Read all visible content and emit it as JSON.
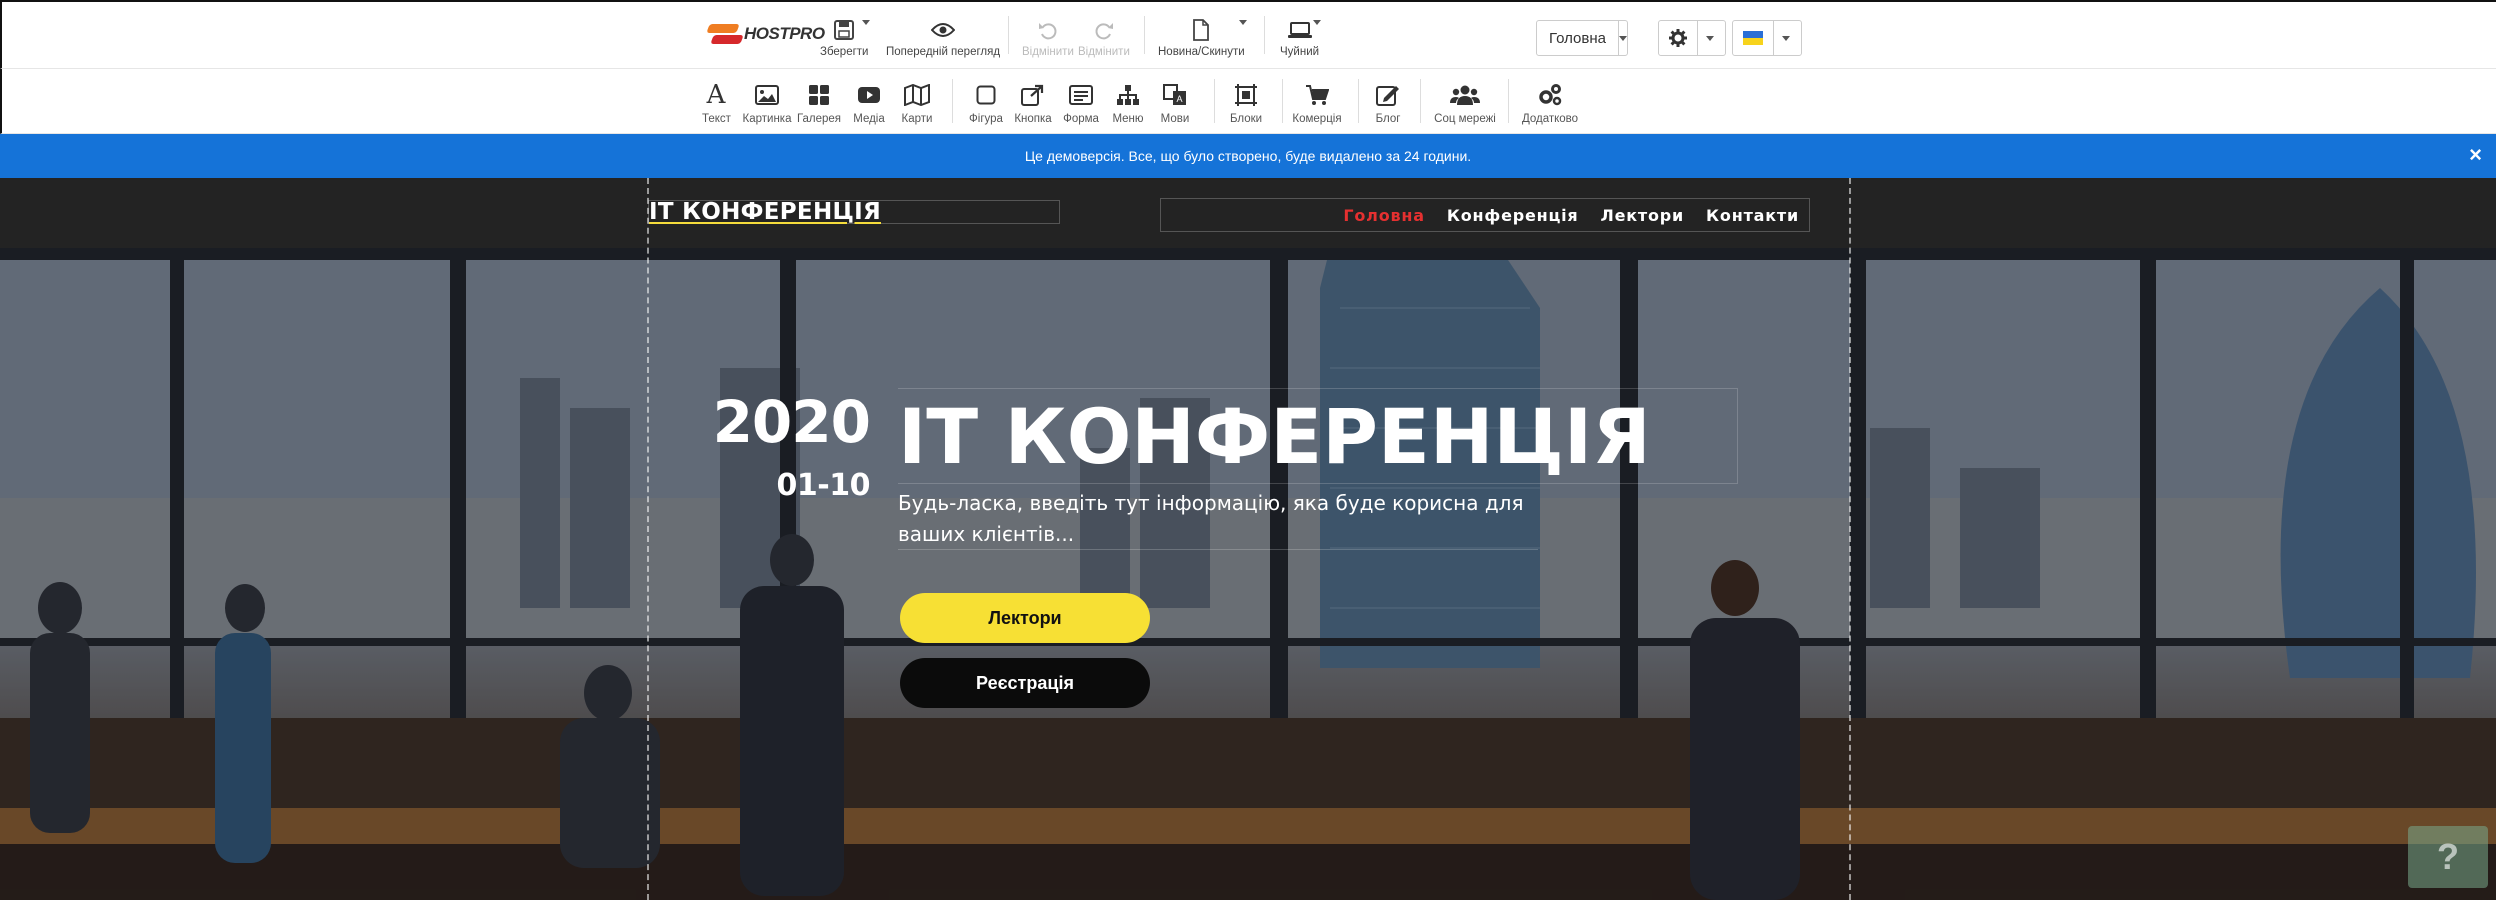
{
  "toolbar": {
    "logo_text": "HOSTPRO",
    "save": "Зберегти",
    "preview": "Попередній перегляд",
    "undo": "Відмінити",
    "redo": "Відмінити",
    "new_reset": "Новина/Скинути",
    "device": "Чуйний",
    "page_select": "Головна",
    "language_flag": "ukraine-flag"
  },
  "widgets": [
    {
      "label": "Текст",
      "icon": "text-icon"
    },
    {
      "label": "Картинка",
      "icon": "image-icon"
    },
    {
      "label": "Галерея",
      "icon": "gallery-icon"
    },
    {
      "label": "Медіа",
      "icon": "media-icon"
    },
    {
      "label": "Карти",
      "icon": "map-icon"
    },
    {
      "label": "Фігура",
      "icon": "shape-icon"
    },
    {
      "label": "Кнопка",
      "icon": "button-icon"
    },
    {
      "label": "Форма",
      "icon": "form-icon"
    },
    {
      "label": "Меню",
      "icon": "menu-icon"
    },
    {
      "label": "Мови",
      "icon": "languages-icon"
    },
    {
      "label": "Блоки",
      "icon": "blocks-icon"
    },
    {
      "label": "Комерція",
      "icon": "cart-icon"
    },
    {
      "label": "Блог",
      "icon": "blog-icon"
    },
    {
      "label": "Соц мережі",
      "icon": "social-icon"
    },
    {
      "label": "Додатково",
      "icon": "gears-icon"
    }
  ],
  "banner": {
    "text": "Це демоверсія. Все, що було створено, буде видалено за 24 години.",
    "close": "×"
  },
  "site": {
    "brand": "IT КОНФЕРЕНЦІЯ",
    "nav": [
      "Головна",
      "Конференція",
      "Лектори",
      "Контакти"
    ],
    "nav_active_color": "#e53030"
  },
  "hero": {
    "year": "2020",
    "dates": "01-10",
    "title": "IT КОНФЕРЕНЦІЯ",
    "subtitle": "Будь-ласка, введіть тут інформацію, яка буде корисна для ваших клієнтів...",
    "button_primary": "Лектори",
    "button_secondary": "Реєстрація",
    "primary_color": "#f7e034"
  },
  "help_button": "?",
  "colors": {
    "banner": "#1573d8",
    "header": "#232323"
  }
}
